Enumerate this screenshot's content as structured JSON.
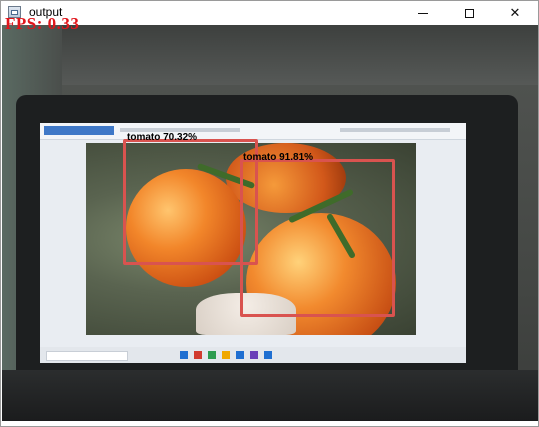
{
  "window": {
    "title": "output",
    "controls": {
      "minimize": "minimize",
      "maximize": "maximize",
      "close": "close"
    }
  },
  "overlay": {
    "fps_text": "FPS:  0.33"
  },
  "detections": [
    {
      "label": "tomato 70.32%"
    },
    {
      "label": "tomato 91.81%"
    }
  ],
  "colors": {
    "fps": "#e0151b",
    "bbox": "#d9534f"
  }
}
